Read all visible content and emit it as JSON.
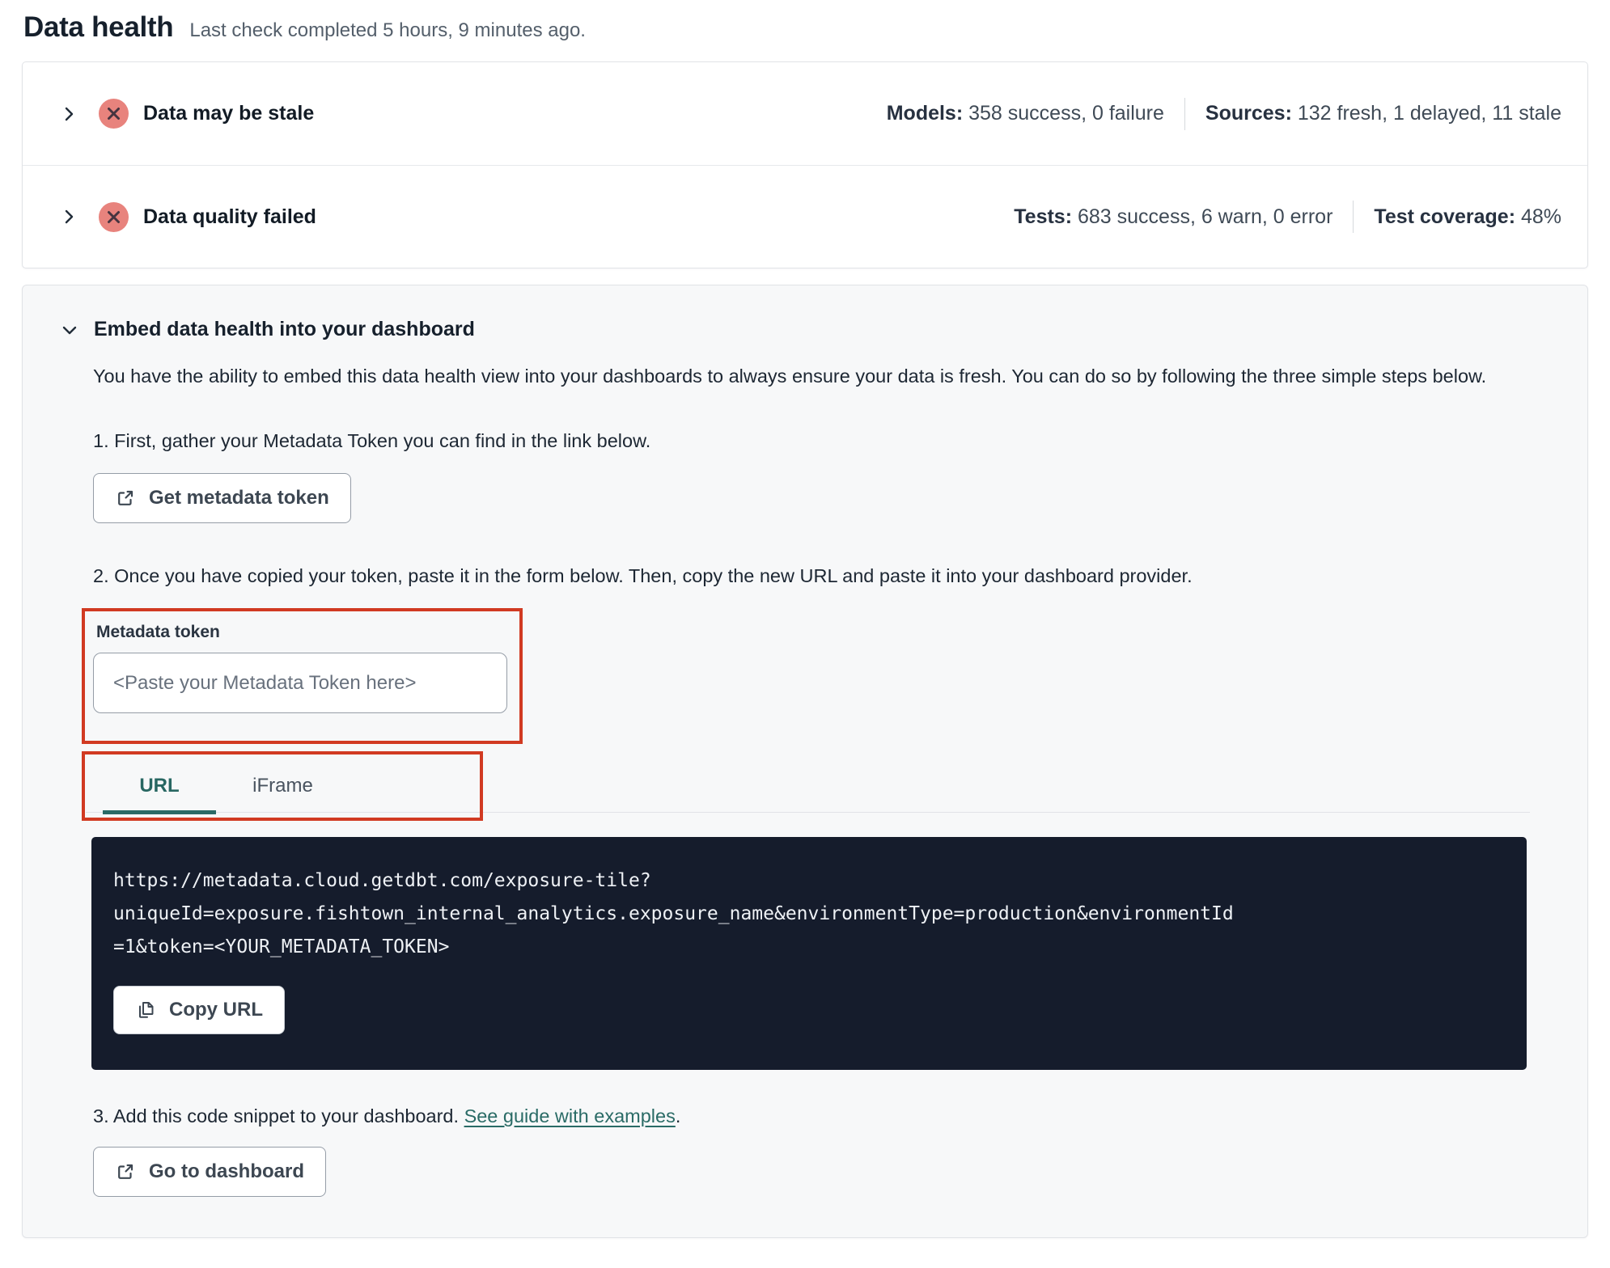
{
  "page": {
    "title": "Data health",
    "last_check": "Last check completed 5 hours, 9 minutes ago."
  },
  "status_rows": [
    {
      "title": "Data may be stale",
      "stats": [
        {
          "label": "Models:",
          "value": " 358 success, 0 failure"
        },
        {
          "label": "Sources:",
          "value": " 132 fresh, 1 delayed, 11 stale"
        }
      ]
    },
    {
      "title": "Data quality failed",
      "stats": [
        {
          "label": "Tests:",
          "value": " 683 success, 6 warn, 0 error"
        },
        {
          "label": "Test coverage:",
          "value": " 48%"
        }
      ]
    }
  ],
  "embed": {
    "title": "Embed data health into your dashboard",
    "description": "You have the ability to embed this data health view into your dashboards to always ensure your data is fresh. You can do so by following the three simple steps below.",
    "step1": "1. First, gather your Metadata Token you can find in the link below.",
    "get_token_button": "Get metadata token",
    "step2": "2. Once you have copied your token, paste it in the form below. Then, copy the new URL and paste it into your dashboard provider.",
    "token_label": "Metadata token",
    "token_placeholder": "<Paste your Metadata Token here>",
    "tabs": [
      {
        "label": "URL",
        "active": true
      },
      {
        "label": "iFrame",
        "active": false
      }
    ],
    "code_lines": [
      "https://metadata.cloud.getdbt.com/exposure-tile?",
      "uniqueId=exposure.fishtown_internal_analytics.exposure_name&environmentType=production&environmentId",
      "=1&token=<YOUR_METADATA_TOKEN>"
    ],
    "copy_button": "Copy URL",
    "step3_prefix": "3. Add this code snippet to your dashboard. ",
    "step3_link": "See guide with examples",
    "step3_suffix": ".",
    "dashboard_button": "Go to dashboard"
  },
  "colors": {
    "annotation_red": "#d13a22",
    "accent_teal": "#2b6a66",
    "error_icon_bg": "#e8837d",
    "code_background": "#151c2c"
  }
}
